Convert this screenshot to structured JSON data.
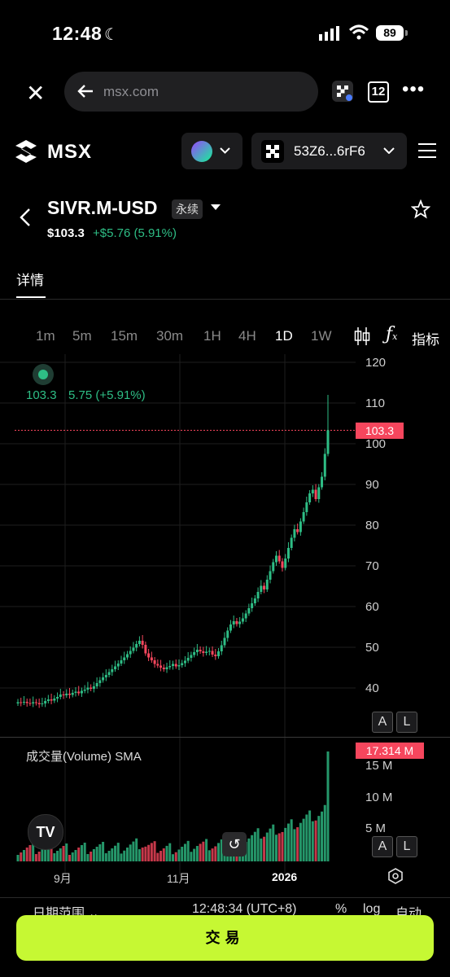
{
  "status_bar": {
    "time": "12:48",
    "battery": "89"
  },
  "browser": {
    "url": "msx.com",
    "tabs_count": "12"
  },
  "header": {
    "logo_text": "MSX",
    "wallet_address": "53Z6...6rF6"
  },
  "instrument": {
    "symbol": "SIVR.M-USD",
    "badge": "永续",
    "price": "$103.3",
    "change": "+$5.76 (5.91%)"
  },
  "tabs": {
    "details": "详情"
  },
  "timeframes": [
    "1m",
    "5m",
    "15m",
    "30m",
    "1H",
    "4H",
    "1D",
    "1W"
  ],
  "active_timeframe": "1D",
  "indicators_label": "指标",
  "chart_overlay": {
    "price": "103.3",
    "change": "5.75 (+5.91%)"
  },
  "price_axis": [
    "120",
    "110",
    "100",
    "90",
    "80",
    "70",
    "60",
    "50",
    "40"
  ],
  "current_price_tag": "103.3",
  "volume": {
    "title": "成交量(Volume) SMA",
    "current": "17.314 M",
    "axis": [
      "15 M",
      "10 M",
      "5 M"
    ]
  },
  "x_axis": [
    "9月",
    "11月",
    "2026"
  ],
  "scale_buttons": {
    "auto": "A",
    "log": "L"
  },
  "bottom_bar": {
    "date_range": "日期范围",
    "clock": "12:48:34 (UTC+8)",
    "percent": "%",
    "log": "log",
    "auto": "自动"
  },
  "trade_button": "交易",
  "colors": {
    "up": "#2ebd85",
    "down": "#f6465d",
    "accent": "#c6f833"
  },
  "chart_data": {
    "type": "candlestick",
    "xlabel": "",
    "ylabel": "",
    "ylim": [
      33,
      122
    ],
    "x": [
      "9月",
      "11月",
      "2026"
    ],
    "close": [
      36.5,
      36.4,
      36.6,
      36.3,
      36.2,
      36.5,
      36.3,
      36.0,
      36.2,
      36.8,
      37.2,
      36.9,
      37.4,
      37.8,
      38.4,
      38.2,
      38.6,
      38.3,
      38.8,
      39.1,
      38.7,
      39.3,
      39.6,
      40.1,
      39.8,
      40.4,
      41.2,
      41.9,
      42.6,
      43.2,
      43.9,
      44.6,
      45.3,
      46.0,
      46.8,
      47.5,
      48.3,
      49.1,
      49.9,
      50.8,
      51.6,
      50.6,
      48.5,
      47.5,
      46.8,
      45.9,
      45.5,
      45.0,
      44.6,
      45.1,
      45.4,
      45.9,
      45.3,
      45.6,
      46.1,
      46.7,
      47.4,
      48.1,
      48.8,
      49.4,
      49.0,
      48.6,
      48.9,
      49.1,
      48.2,
      47.8,
      49.0,
      50.5,
      52.3,
      54.1,
      55.6,
      56.4,
      55.7,
      56.3,
      57.1,
      58.3,
      59.6,
      60.8,
      62.0,
      63.6,
      65.1,
      64.2,
      66.6,
      68.7,
      70.9,
      72.5,
      71.1,
      69.5,
      71.8,
      74.4,
      76.9,
      79.0,
      78.3,
      80.9,
      83.2,
      85.6,
      87.8,
      88.7,
      86.4,
      89.3,
      91.9,
      97.5,
      103.3
    ],
    "high_last": 112.0
  }
}
